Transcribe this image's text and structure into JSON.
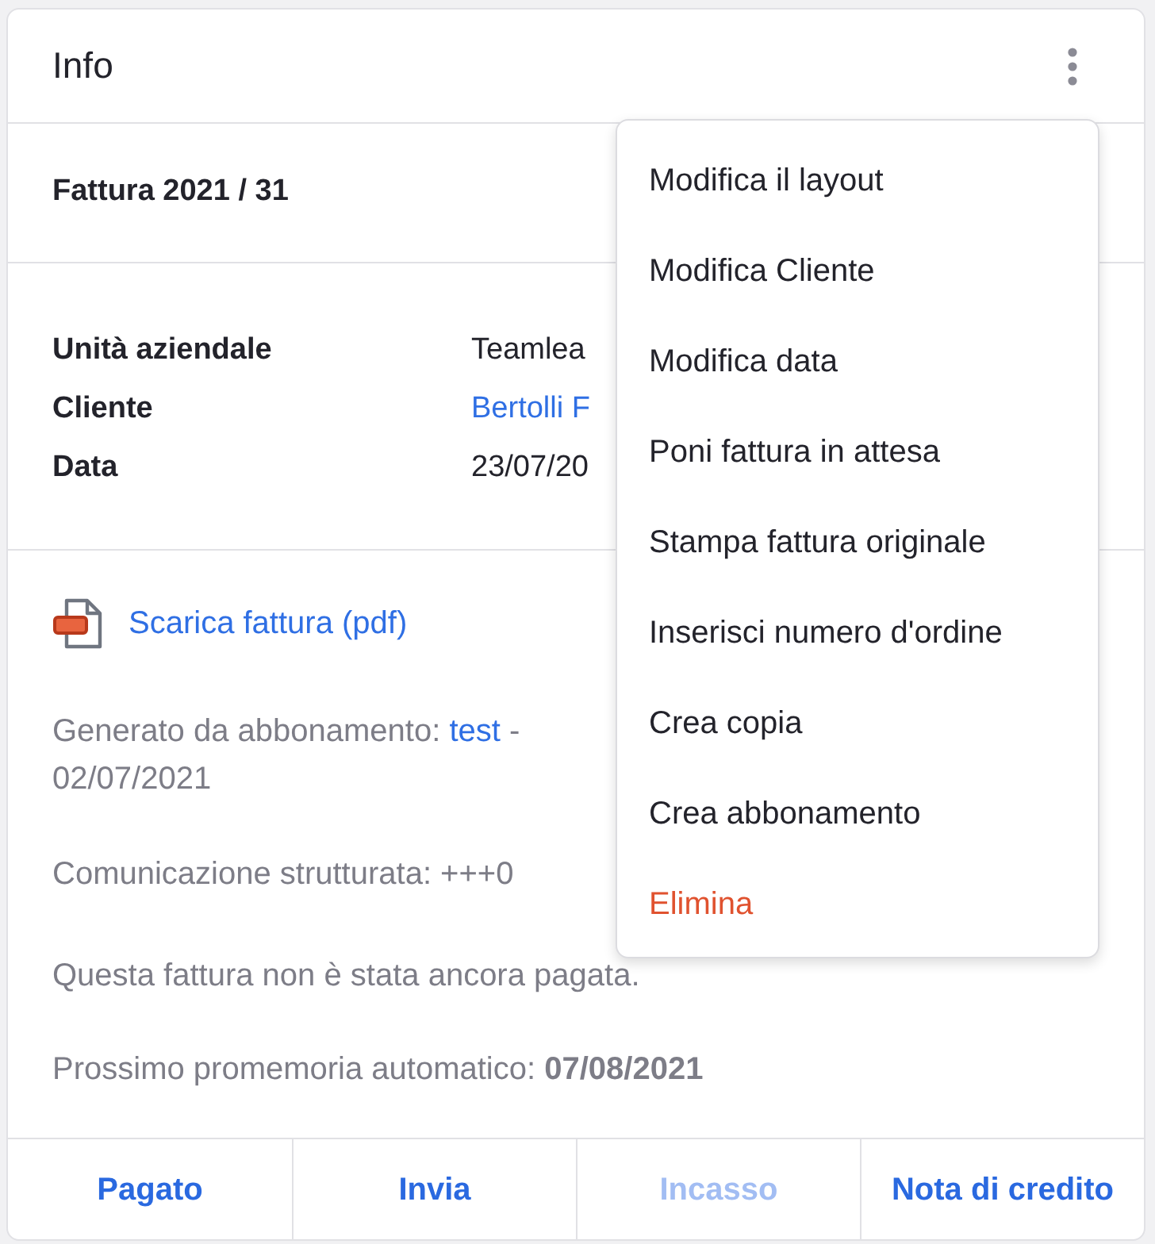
{
  "header": {
    "title": "Info"
  },
  "invoice": {
    "title": "Fattura 2021 / 31"
  },
  "details": [
    {
      "label": "Unità aziendale",
      "value": "Teamlea",
      "kind": "text"
    },
    {
      "label": "Cliente",
      "value": "Bertolli F",
      "kind": "link"
    },
    {
      "label": "Data",
      "value": "23/07/20",
      "kind": "text"
    }
  ],
  "download": {
    "label": "Scarica fattura (pdf)"
  },
  "notes": [
    {
      "kind": "subscription",
      "text": "Generato da abbonamento: ",
      "link": "test",
      "after": " -",
      "line_2": "02/07/2021"
    },
    {
      "kind": "plain",
      "text": "Comunicazione strutturata: +++0"
    },
    {
      "kind": "plain",
      "text": "Questa fattura non è stata ancora pagata."
    },
    {
      "kind": "plain",
      "text": "Prossimo promemoria automatico: **07/08/2021**"
    }
  ],
  "actions": [
    {
      "label": "Pagato",
      "disabled": false
    },
    {
      "label": "Invia",
      "disabled": false
    },
    {
      "label": "Incasso",
      "disabled": true
    },
    {
      "label": "Nota di credito",
      "disabled": false
    }
  ],
  "menu": {
    "open": true,
    "items": [
      {
        "label": "Modifica il layout",
        "kind": "normal"
      },
      {
        "label": "Modifica Cliente",
        "kind": "normal"
      },
      {
        "label": "Modifica data",
        "kind": "normal"
      },
      {
        "label": "Poni fattura in attesa",
        "kind": "normal"
      },
      {
        "label": "Stampa fattura originale",
        "kind": "normal"
      },
      {
        "label": "Inserisci numero d'ordine",
        "kind": "normal"
      },
      {
        "label": "Crea copia",
        "kind": "normal"
      },
      {
        "label": "Crea abbonamento",
        "kind": "normal"
      },
      {
        "label": "Elimina",
        "kind": "danger"
      }
    ]
  }
}
